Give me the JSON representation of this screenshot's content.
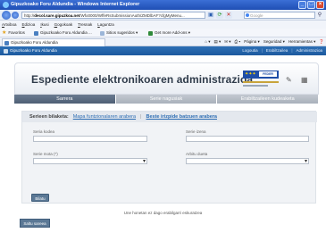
{
  "window": {
    "title": "Gipuzkoako Foru Aldundia - Windows Internet Explorer"
  },
  "addressbar": {
    "url_prefix": "http://",
    "url_host": "decol.sare.gipuzkoa.net",
    "url_path": "/Wfo0000/WffeRsSubmissionAuth/ZMDlbAF?cfgMyMenu...",
    "search_placeholder": "Google"
  },
  "menubar": {
    "items": [
      "Artxiboa",
      "Edizioa",
      "Ikusi",
      "Gogokoak",
      "Tresnak",
      "Laguntza"
    ]
  },
  "favbar": {
    "favorites_label": "Favoritos",
    "fav1": "Gipuzkoako Foru Aldundia ...",
    "fav2": "Sitios sugeridos ▾",
    "fav3": "Get more Add-ons ▾"
  },
  "cmdbar": {
    "tab_title": "Gipuzkoako Foru Aldundia",
    "page_label": "Página ▾",
    "security_label": "Seguridad ▾",
    "tools_label": "Herramientas ▾"
  },
  "page": {
    "org_name": "Gipuzkoako Foru Aldundia",
    "top_links": [
      "Logoutia",
      "Erabiltzailea",
      "Administrazioa"
    ],
    "title": "Espediente elektronikoaren administrazioa",
    "eu_logo_text": "FEDER",
    "tabs": [
      "Sarrera",
      "Serie nagusiak",
      "Erabiltzaileen kudeaketa"
    ],
    "search": {
      "label": "Serieen bilaketa:",
      "link1": "Mapa funtzionalaren arabera",
      "separator": "|",
      "link2": "Beste irizpide batzuen arabera",
      "field1_label": "Seria kodea",
      "field2_label": "Serie izena",
      "field3_label": "Serie mota (*)",
      "field4_label": "Arbitu dueta",
      "button": "Bilatu"
    },
    "notice": "Une honetan ez dago erabilgarri eskuratzea",
    "exit_button": "Saltu sareea"
  },
  "colors": {
    "ie_titlebar": "#1f4fb4",
    "page_header": "#2d6fb5",
    "tab_active": "#4e5f75",
    "button": "#5b7895",
    "link": "#2d6db3"
  }
}
